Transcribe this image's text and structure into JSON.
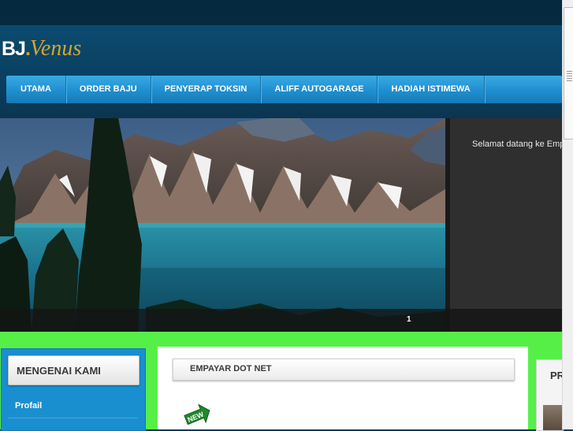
{
  "header": {
    "logo_main": "BJ",
    "logo_dot": ".",
    "logo_sub": "Venus"
  },
  "nav": {
    "items": [
      {
        "label": "UTAMA"
      },
      {
        "label": "ORDER BAJU"
      },
      {
        "label": "PENYERAP TOKSIN"
      },
      {
        "label": "ALIFF AUTOGARAGE"
      },
      {
        "label": "HADIAH ISTIMEWA"
      }
    ]
  },
  "slider": {
    "caption": "Selamat datang ke Emp",
    "page_number": "1"
  },
  "sidebar": {
    "title": "MENGENAI KAMI",
    "link": "Profail"
  },
  "main": {
    "title": "EMPAYAR DOT NET",
    "badge": "NEW"
  },
  "right": {
    "title": "PR"
  },
  "colors": {
    "nav_blue": "#1f8fd0",
    "header_dark": "#0a3d5c",
    "logo_gold": "#d7a52d",
    "background_green": "#56ef48"
  }
}
